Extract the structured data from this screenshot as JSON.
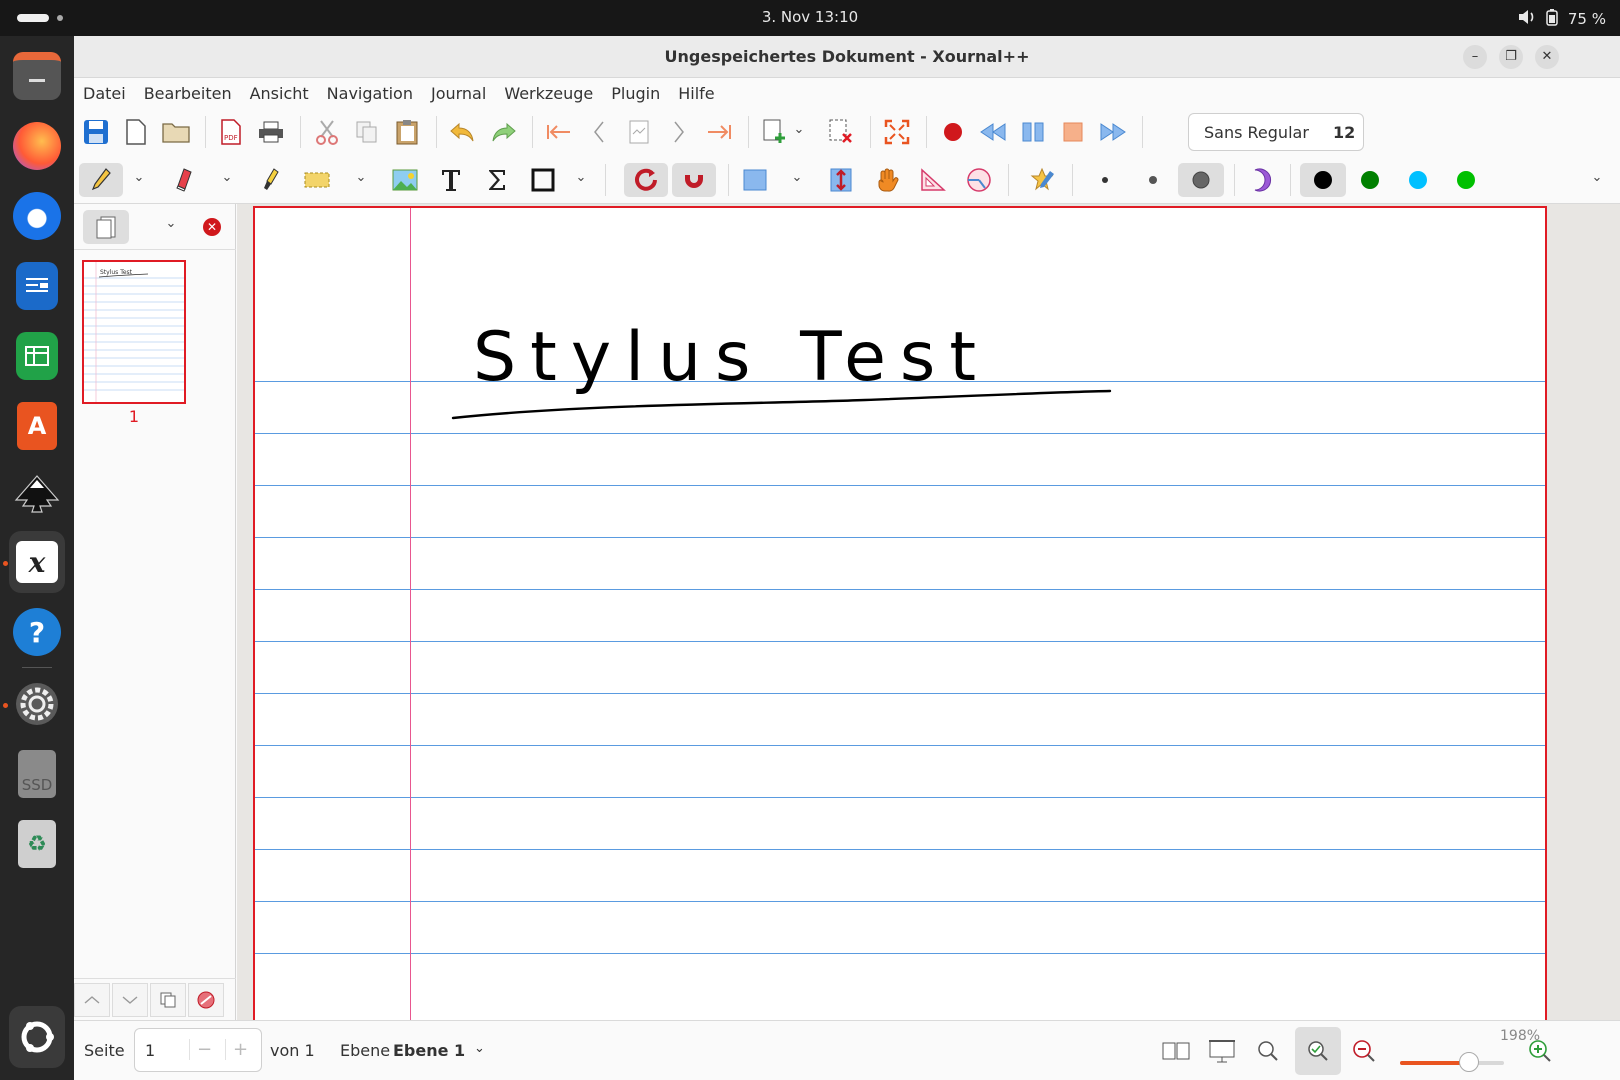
{
  "system": {
    "clock": "3. Nov  13:10",
    "battery": "75 %"
  },
  "dock": {
    "items": [
      "files-icon",
      "firefox-icon",
      "thunderbird-icon",
      "writer-icon",
      "calc-icon",
      "app-center-icon",
      "inkscape-icon",
      "xournalpp-icon",
      "help-icon",
      "settings-icon",
      "ssd-drive-icon",
      "trash-icon",
      "ubuntu-apps-icon"
    ],
    "ssd_label": "SSD"
  },
  "window": {
    "title": "Ungespeichertes Dokument - Xournal++"
  },
  "menu": [
    "Datei",
    "Bearbeiten",
    "Ansicht",
    "Navigation",
    "Journal",
    "Werkzeuge",
    "Plugin",
    "Hilfe"
  ],
  "toolbar": {
    "font_name": "Sans Regular",
    "font_size": "12",
    "colors": [
      "#000000",
      "#008000",
      "#00c0ff",
      "#00c000"
    ],
    "selected_color": "#000000",
    "accent_red": "#e01b24"
  },
  "sidebar": {
    "page_number": "1",
    "thumb_text": "Stylus Test"
  },
  "page": {
    "handwriting": "Stylus Test",
    "ruling_color": "#5a9be0",
    "margin_color": "#e8568f"
  },
  "status": {
    "page_label": "Seite",
    "page_value": "1",
    "of_label": "von 1",
    "layer_label": "Ebene",
    "layer_value": "Ebene 1",
    "zoom": "198%",
    "zoom_fraction": 0.66
  }
}
